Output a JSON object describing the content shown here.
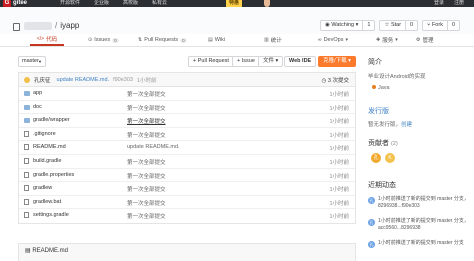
{
  "topbar": {
    "logo_mark": "G",
    "logo_text": "gitee",
    "nav": [
      "开源软件",
      "企业版",
      "高校版",
      "私有云"
    ],
    "badge": "特惠",
    "right": [
      "登录",
      "注册"
    ]
  },
  "repo": {
    "name_suffix": "iyapp",
    "watch_label": "Watching",
    "watch_count": "1",
    "star_label": "Star",
    "star_count": "0",
    "fork_label": "Fork",
    "fork_count": "0"
  },
  "tabs": [
    {
      "label": "代码",
      "icon": "code-icon",
      "count": ""
    },
    {
      "label": "Issues",
      "icon": "issues-icon",
      "count": "0"
    },
    {
      "label": "Pull Requests",
      "icon": "pull-request-icon",
      "count": "0"
    },
    {
      "label": "Wiki",
      "icon": "wiki-icon",
      "count": ""
    },
    {
      "label": "统计",
      "icon": "stats-icon",
      "count": ""
    },
    {
      "label": "DevOps",
      "icon": "devops-icon",
      "count": ""
    },
    {
      "label": "服务",
      "icon": "service-icon",
      "count": ""
    },
    {
      "label": "管理",
      "icon": "manage-icon",
      "count": ""
    }
  ],
  "toolbar": {
    "branch": "master",
    "pull_request": "+ Pull Request",
    "issue": "+ Issue",
    "file": "文件",
    "web_ide": "Web IDE",
    "clone": "克隆/下载"
  },
  "commit": {
    "author": "孔庆征",
    "message": "update README.md.",
    "hash": "f90e303",
    "time": "1小时前",
    "count": "3 次提交"
  },
  "files": [
    {
      "name": "app",
      "type": "dir",
      "commit": "第一次全部提交",
      "time": "1小时前"
    },
    {
      "name": "doc",
      "type": "dir",
      "commit": "第一次全部提交",
      "time": "1小时前"
    },
    {
      "name": "gradle/wrapper",
      "type": "dir",
      "commit": "第一次全部提交",
      "time": "1小时前"
    },
    {
      "name": ".gitignore",
      "type": "file",
      "commit": "第一次全部提交",
      "time": "1小时前"
    },
    {
      "name": "README.md",
      "type": "file",
      "commit": "update README.md.",
      "time": "1小时前"
    },
    {
      "name": "build.gradle",
      "type": "file",
      "commit": "第一次全部提交",
      "time": "1小时前"
    },
    {
      "name": "gradle.properties",
      "type": "file",
      "commit": "第一次全部提交",
      "time": "1小时前"
    },
    {
      "name": "gradlew",
      "type": "file",
      "commit": "第一次全部提交",
      "time": "1小时前"
    },
    {
      "name": "gradlew.bat",
      "type": "file",
      "commit": "第一次全部提交",
      "time": "1小时前"
    },
    {
      "name": "settings.gradle",
      "type": "file",
      "commit": "第一次全部提交",
      "time": "1小时前"
    }
  ],
  "readme": {
    "title": "README.md"
  },
  "sidebar": {
    "intro_title": "简介",
    "intro_text": "毕业设计Android的实现",
    "language": "Java",
    "release_title": "发行版",
    "release_text": "暂无发行版，",
    "release_link": "创建",
    "contrib_title": "贡献者",
    "contrib_count": "(2)",
    "contributors": [
      "孔",
      "K"
    ],
    "activity_title": "近期动态",
    "activities": [
      {
        "avatar": "孔",
        "text": "1小时前推送了新的提交到 master 分支，8296938...f90e303"
      },
      {
        "avatar": "孔",
        "text": "1小时前推送了新的提交到 master 分支，acc9560...8296938"
      },
      {
        "avatar": "孔",
        "text": "1小时前推送了新的提交到 master 分支"
      }
    ]
  },
  "colors": {
    "accent": "#c7371f",
    "clone_button": "#fd7a2c",
    "link": "#4183c4",
    "topbar": "#2b2f33"
  }
}
